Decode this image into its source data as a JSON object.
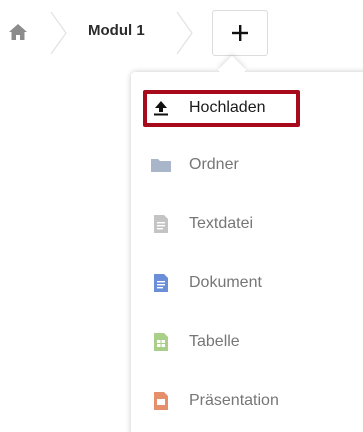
{
  "breadcrumb": {
    "home_icon": "home-icon",
    "current_label": "Modul 1",
    "add_icon": "plus-icon"
  },
  "menu": {
    "items": [
      {
        "label": "Hochladen",
        "icon": "upload-icon",
        "color": "#111111"
      },
      {
        "label": "Ordner",
        "icon": "folder-icon",
        "color": "#a9b6c9"
      },
      {
        "label": "Textdatei",
        "icon": "text-file-icon",
        "color": "#c4c4c4"
      },
      {
        "label": "Dokument",
        "icon": "document-icon",
        "color": "#6b8ed8"
      },
      {
        "label": "Tabelle",
        "icon": "spreadsheet-icon",
        "color": "#a9cf88"
      },
      {
        "label": "Präsentation",
        "icon": "presentation-icon",
        "color": "#e5906a"
      }
    ]
  },
  "colors": {
    "highlight_border": "#a70a1a"
  }
}
